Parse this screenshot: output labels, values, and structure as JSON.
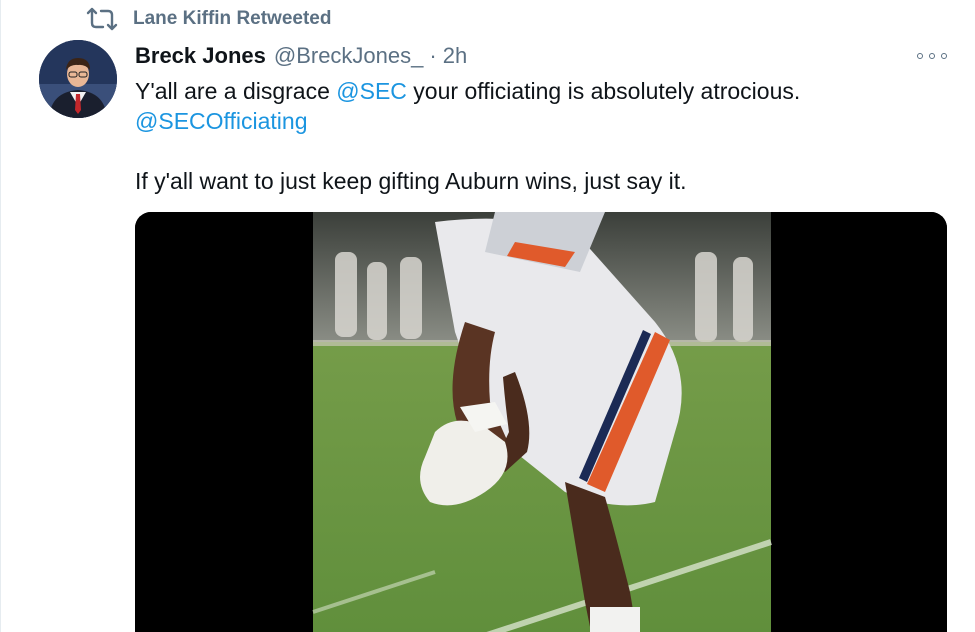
{
  "retweet": {
    "label": "Lane Kiffin Retweeted",
    "icon": "retweet-icon"
  },
  "author": {
    "display_name": "Breck Jones",
    "handle": "@BreckJones_",
    "separator": "·",
    "timestamp": "2h",
    "avatar_icon": "profile-photo"
  },
  "tweet": {
    "line1_prefix": "Y'all are a disgrace ",
    "mention1": "@SEC",
    "line1_suffix": " your officiating is absolutely atrocious.",
    "mention2": "@SECOfficiating",
    "line2": "If y'all want to just keep gifting Auburn wins, just say it."
  },
  "media": {
    "type": "video",
    "subject": "football-player-auburn-uniform"
  },
  "colors": {
    "link": "#1b95e0",
    "secondary_text": "#5b7083",
    "primary_text": "#0f1419",
    "field_green": "#6e9a45",
    "auburn_orange": "#e05a2b"
  }
}
